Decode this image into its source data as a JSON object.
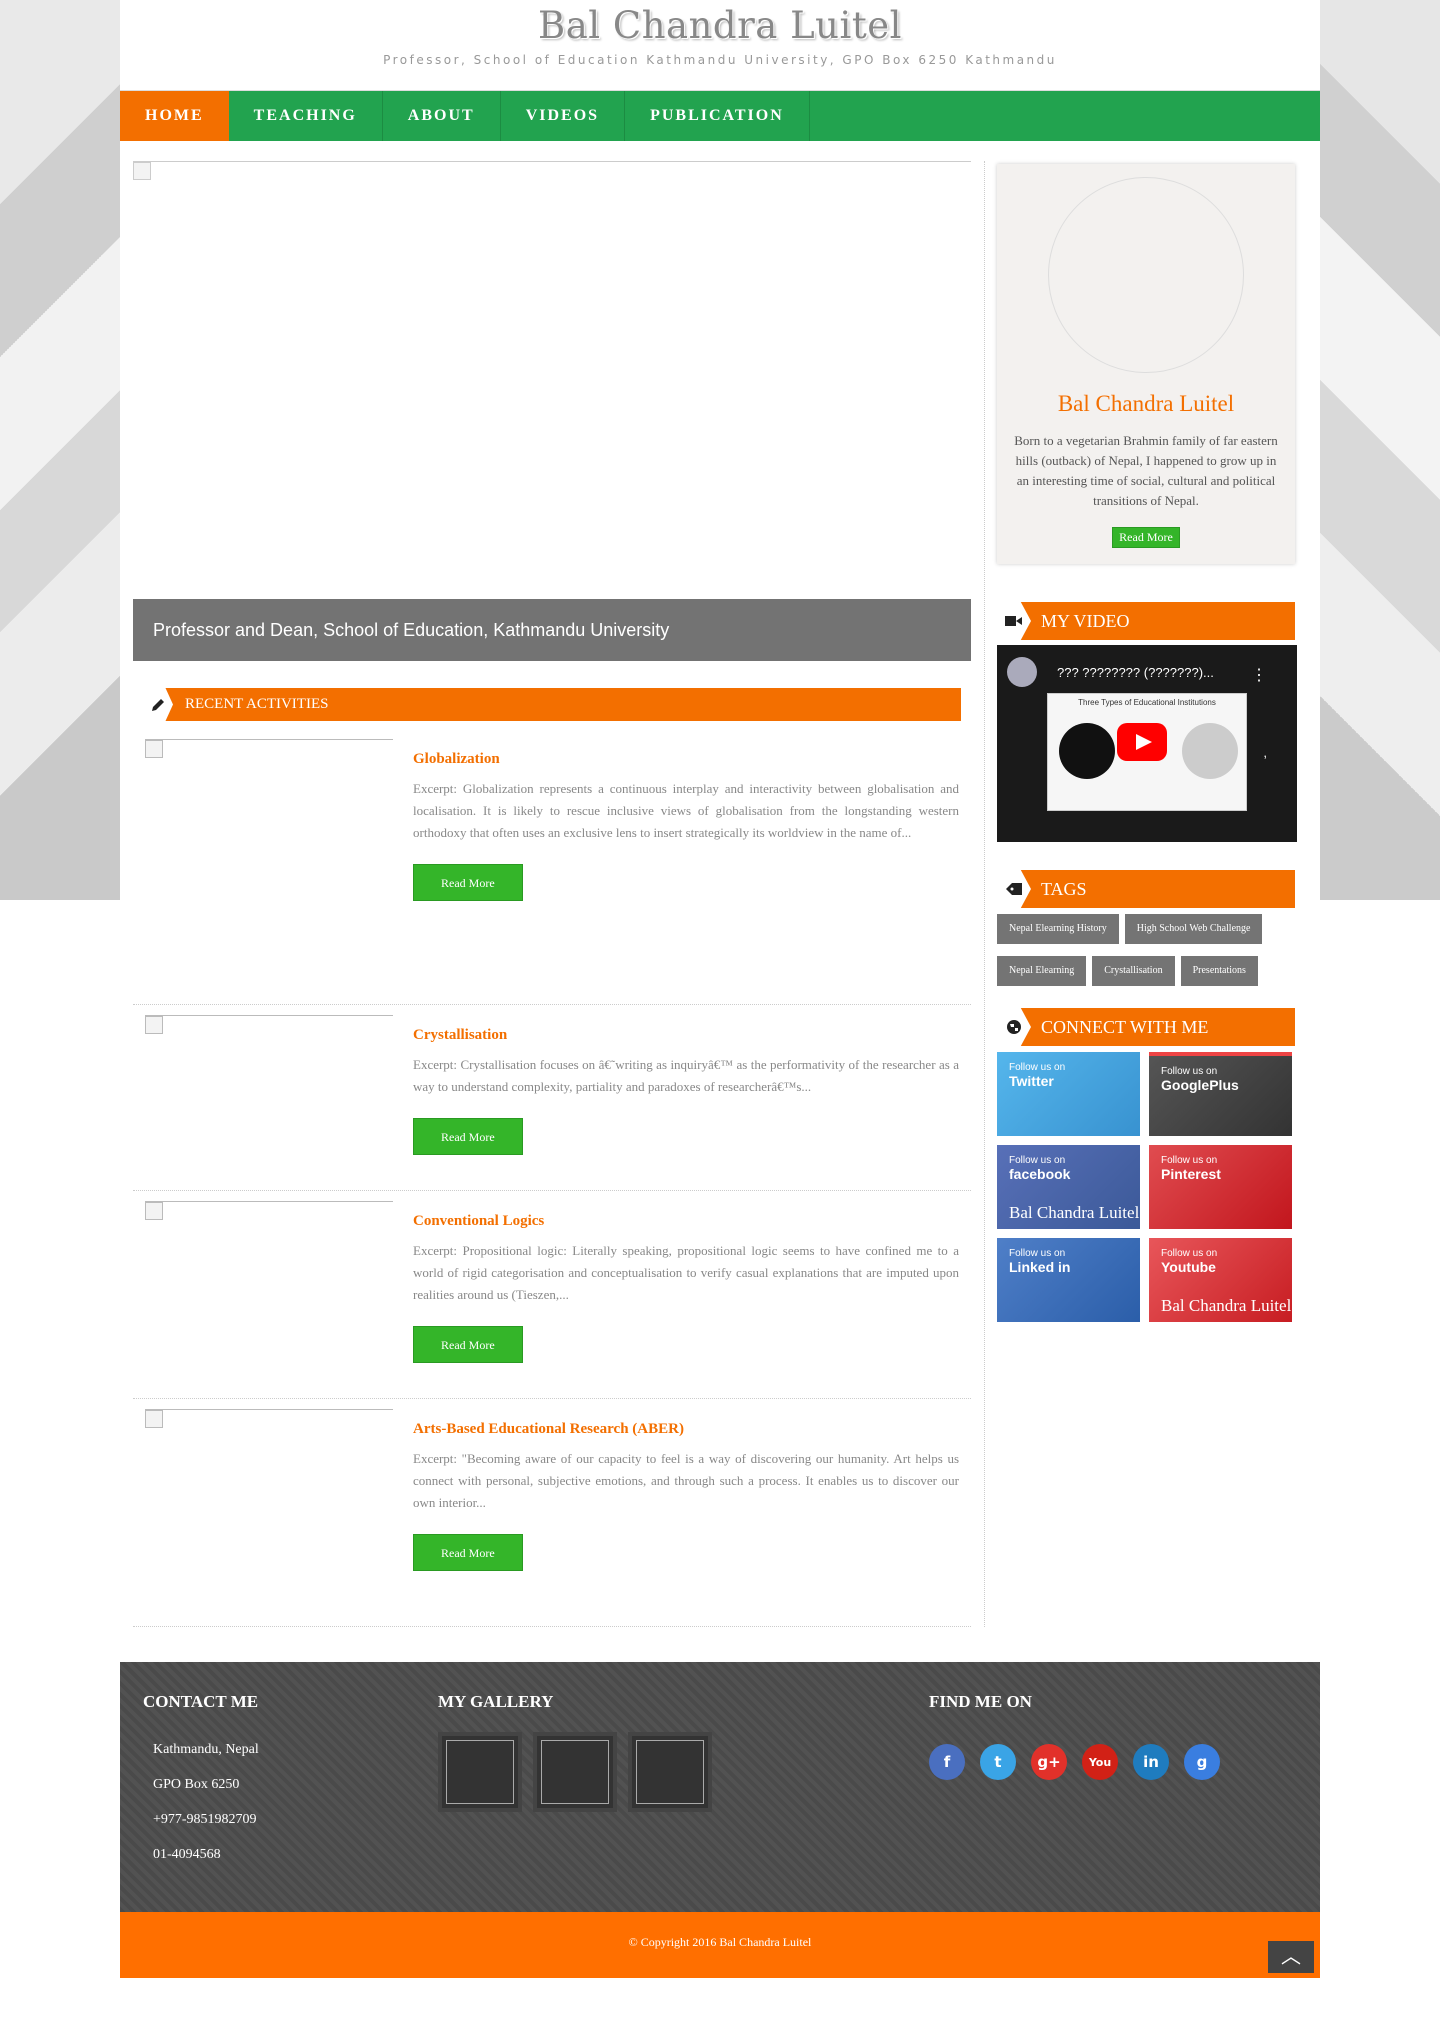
{
  "header": {
    "title": "Bal Chandra Luitel",
    "subtitle": "Professor, School of Education Kathmandu University, GPO Box 6250 Kathmandu"
  },
  "nav": [
    "HOME",
    "TEACHING",
    "ABOUT",
    "VIDEOS",
    "PUBLICATION"
  ],
  "slider": {
    "caption": "Professor and Dean, School of Education, Kathmandu University"
  },
  "recent": {
    "title": "RECENT ACTIVITIES",
    "posts": [
      {
        "title": "Globalization",
        "excerpt": "Excerpt: Globalization represents a continuous interplay and interactivity between globalisation and localisation. It is likely to rescue inclusive views of globalisation from the longstanding western orthodoxy that often uses an exclusive lens to insert strategically its worldview in the name of...",
        "button": "Read More"
      },
      {
        "title": "Crystallisation",
        "excerpt": "Excerpt: Crystallisation focuses on â€˜writing as inquiryâ€™ as the performativity of the researcher as a way to understand complexity, partiality and paradoxes of researcherâ€™s...",
        "button": "Read More"
      },
      {
        "title": "Conventional Logics",
        "excerpt": "Excerpt: Propositional logic: Literally speaking, propositional logic seems to have confined me to a world of rigid categorisation and conceptualisation to verify casual explanations that are imputed upon realities around us (Tieszen,...",
        "button": "Read More"
      },
      {
        "title": "Arts-Based Educational Research (ABER)",
        "excerpt": "Excerpt: \"Becoming aware of our capacity to feel is a way of discovering our humanity. Art helps us connect with personal, subjective emotions, and through such a process. It enables us to discover our own interior...",
        "button": "Read More"
      }
    ]
  },
  "profile": {
    "name": "Bal Chandra Luitel",
    "bio": "Born to a vegetarian Brahmin family of far eastern hills (outback) of Nepal, I happened to grow up in an interesting time of social, cultural and political transitions of Nepal.",
    "button": "Read More"
  },
  "video": {
    "title": "MY VIDEO",
    "video_title": "??? ???????? (???????)...",
    "slide_text": "Three Types of Educational Institutions",
    "menu": "⋮",
    "mark": ","
  },
  "tags": {
    "title": "TAGS",
    "items": [
      "Nepal Elearning History",
      "High School Web Challenge",
      "Nepal Elearning",
      "Crystallisation",
      "Presentations"
    ]
  },
  "connect": {
    "title": "CONNECT WITH ME",
    "cards": [
      {
        "follow": "Follow us on",
        "network": "Twitter",
        "name": ""
      },
      {
        "follow": "Follow us on",
        "network": "GooglePlus",
        "name": ""
      },
      {
        "follow": "Follow us on",
        "network": "facebook",
        "name": "Bal Chandra Luitel"
      },
      {
        "follow": "Follow us on",
        "network": "Pinterest",
        "name": ""
      },
      {
        "follow": "Follow us on",
        "network": "Linked in",
        "name": ""
      },
      {
        "follow": "Follow us on",
        "network": "Youtube",
        "name": "Bal Chandra Luitel"
      }
    ]
  },
  "footer": {
    "contact_title": "CONTACT ME",
    "contact": [
      "Kathmandu, Nepal",
      "GPO Box 6250",
      "+977-9851982709",
      "01-4094568"
    ],
    "gallery_title": "MY GALLERY",
    "find_title": "FIND ME ON",
    "social_icons": [
      "f",
      "t",
      "g+",
      "You",
      "in",
      "g"
    ],
    "social_colors": [
      "#4a6fc0",
      "#3aa4e6",
      "#e2312a",
      "#d22116",
      "#1f7cbf",
      "#3a7ee0"
    ],
    "copyright": "© Copyright 2016 Bal Chandra Luitel",
    "up": "︿"
  }
}
